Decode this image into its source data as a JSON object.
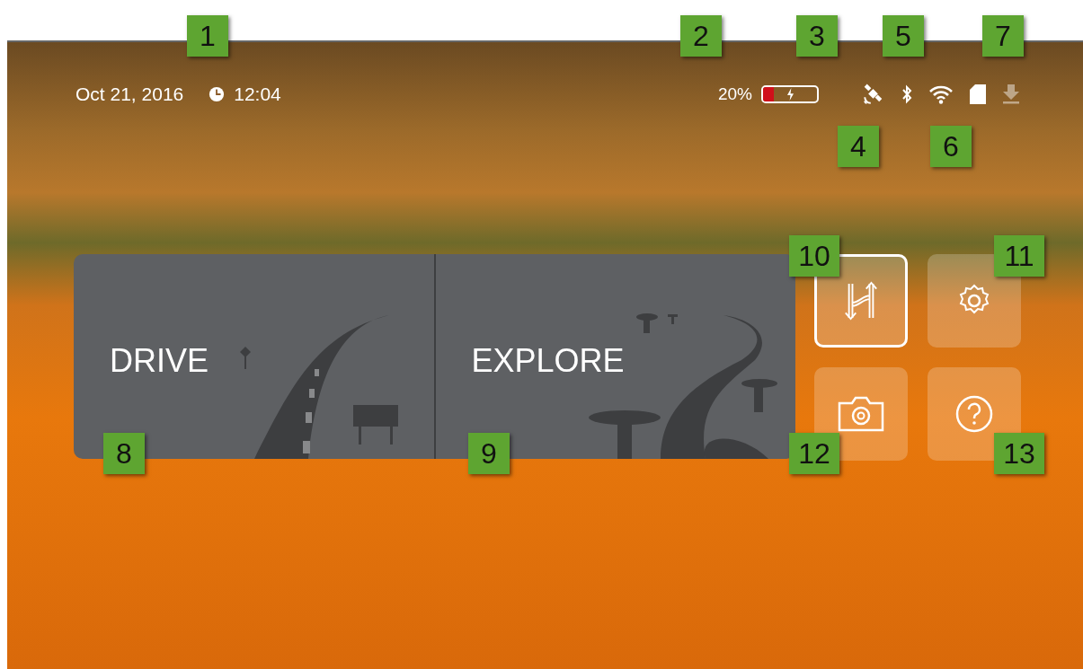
{
  "status_bar": {
    "date": "Oct 21, 2016",
    "time": "12:04",
    "battery": {
      "reading": "20%",
      "level": 0.2,
      "charging": true
    },
    "icons": [
      {
        "kind": "satellite",
        "active": true
      },
      {
        "kind": "bluetooth",
        "active": true
      },
      {
        "kind": "wifi",
        "active": true
      },
      {
        "kind": "sd-card",
        "active": true
      },
      {
        "kind": "download",
        "active": false
      }
    ]
  },
  "modes": [
    {
      "label": "DRIVE",
      "kind": "drive"
    },
    {
      "label": "EXPLORE",
      "kind": "explore"
    }
  ],
  "quick_buttons": [
    {
      "kind": "routes",
      "selected": true
    },
    {
      "kind": "settings",
      "selected": false
    },
    {
      "kind": "camera",
      "selected": false
    },
    {
      "kind": "help",
      "selected": false
    }
  ],
  "callouts": [
    "1",
    "2",
    "3",
    "4",
    "5",
    "6",
    "7",
    "8",
    "9",
    "10",
    "11",
    "12",
    "13"
  ]
}
